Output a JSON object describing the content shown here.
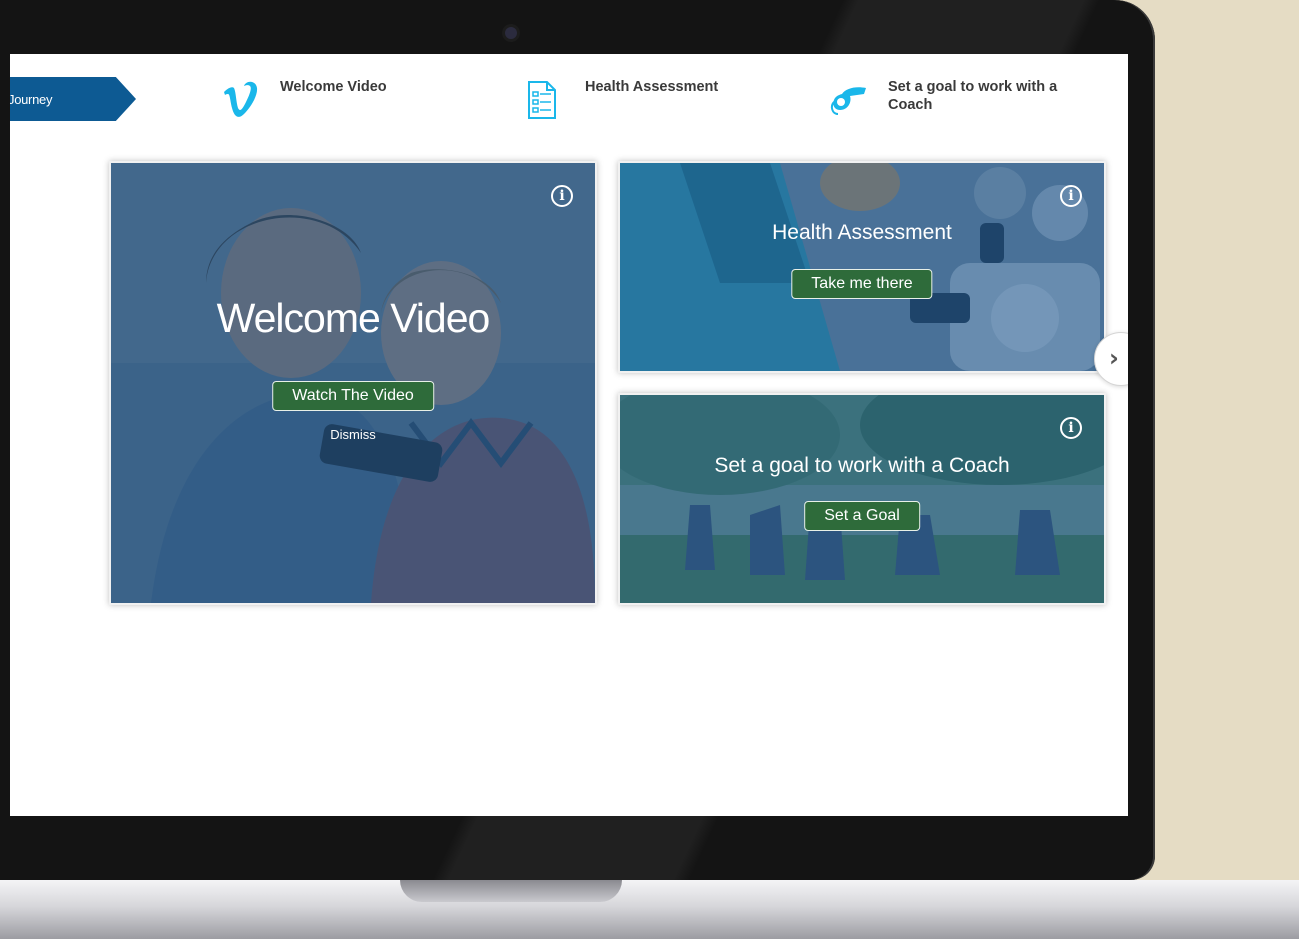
{
  "journey": {
    "label": "Journey"
  },
  "steps": [
    {
      "label": "Welcome Video",
      "icon": "vimeo-icon"
    },
    {
      "label": "Health Assessment",
      "icon": "checklist-icon"
    },
    {
      "label": "Set a goal to work with a Coach",
      "icon": "whistle-icon"
    }
  ],
  "cards": {
    "video": {
      "title": "Welcome Video",
      "button": "Watch The Video",
      "dismiss": "Dismiss",
      "info": "i"
    },
    "health": {
      "title": "Health Assessment",
      "button": "Take me there",
      "info": "i"
    },
    "goal": {
      "title": "Set a goal to work with a Coach",
      "button": "Set a Goal",
      "info": "i"
    }
  },
  "navigation": {
    "next": "›"
  },
  "colors": {
    "accent_blue": "#0d5a93",
    "icon_teal": "#1ab7ea",
    "button_green": "#2e6b3a",
    "background": "#e5dcc4"
  }
}
